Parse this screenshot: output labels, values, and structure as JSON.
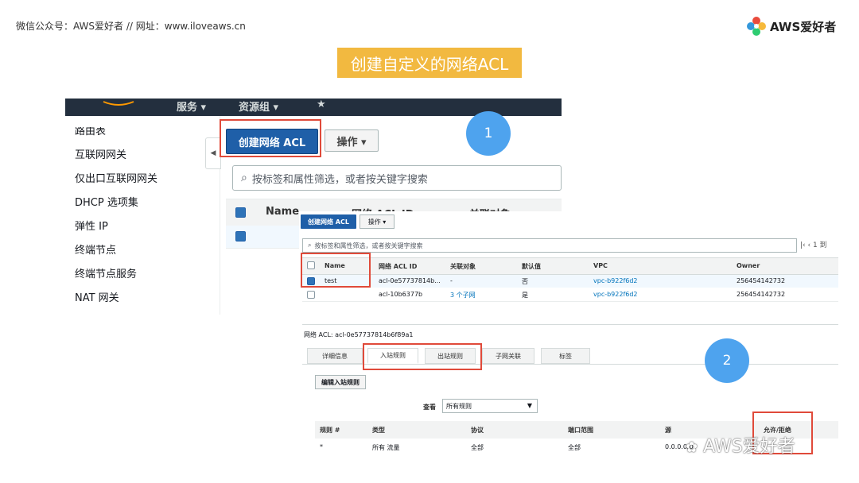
{
  "header": {
    "source_text": "微信公众号：AWS爱好者  //  网址：www.iloveaws.cn",
    "logo_text": "AWS爱好者"
  },
  "title": "创建自定义的网络ACL",
  "navbar": {
    "services": "服务 ▾",
    "resource_groups": "资源组 ▾",
    "star": "★"
  },
  "sidebar": {
    "items": [
      "路由表",
      "互联网网关",
      "仅出口互联网网关",
      "DHCP 选项集",
      "弹性 IP",
      "终端节点",
      "终端节点服务",
      "NAT 网关"
    ]
  },
  "toolbar": {
    "create_label": "创建网络 ACL",
    "actions_label": "操作 ▾"
  },
  "search": {
    "placeholder": "按标签和属性筛选，或者按关键字搜索"
  },
  "table1": {
    "headers": [
      "Name",
      "网络 ACL ID",
      "关联对象"
    ]
  },
  "badges": [
    "1",
    "2"
  ],
  "panel2": {
    "create_label": "创建网络 ACL",
    "actions_label": "操作 ▾",
    "search_placeholder": "按标签和属性筛选，或者按关键字搜索",
    "pager": "|‹  ‹  1 到",
    "headers": [
      "Name",
      "网络 ACL ID",
      "关联对象",
      "默认值",
      "VPC",
      "Owner"
    ],
    "rows": [
      {
        "name": "test",
        "acl_id": "acl-0e57737814b...",
        "assoc": "-",
        "default": "否",
        "vpc": "vpc-b922f6d2",
        "owner": "256454142732"
      },
      {
        "name": "",
        "acl_id": "acl-10b6377b",
        "assoc": "3 个子网",
        "default": "是",
        "vpc": "vpc-b922f6d2",
        "owner": "256454142732"
      }
    ]
  },
  "details": {
    "acl_label": "网络 ACL: acl-0e57737814b6f89a1",
    "tabs": [
      "详细信息",
      "入站规则",
      "出站规则",
      "子网关联",
      "标签"
    ],
    "edit_button": "编辑入站规则",
    "view_label": "查看",
    "view_value": "所有规则",
    "rule_headers": [
      "规则 #",
      "类型",
      "协议",
      "端口范围",
      "源",
      "允许/拒绝"
    ],
    "rule_row": [
      "*",
      "所有 流量",
      "全部",
      "全部",
      "0.0.0.0/0",
      ""
    ]
  },
  "watermark": "AWS爱好者",
  "colors": {
    "title_bg": "#f2b940",
    "highlight": "#e04a3a",
    "badge": "#4ea3ee",
    "primary": "#1f5fa8",
    "navbar": "#232f3e"
  }
}
